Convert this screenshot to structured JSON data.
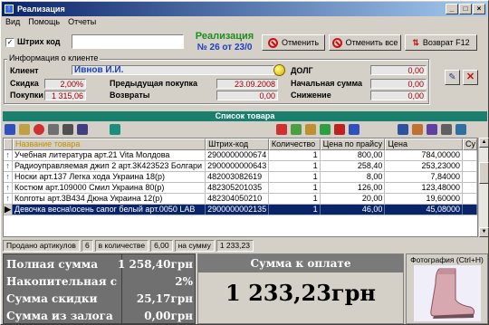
{
  "window": {
    "title": "Реализация"
  },
  "menu": [
    "Вид",
    "Помощь",
    "Отчеты"
  ],
  "barcode": {
    "label": "Штрих код",
    "checked": true,
    "value": ""
  },
  "sale": {
    "title": "Реализация",
    "number": "№ 26 от 23/0"
  },
  "buttons": {
    "cancel": "Отменить",
    "cancel_all": "Отменить все",
    "return": "Возврат F12"
  },
  "client_group": {
    "legend": "Информация о клиенте",
    "client_label": "Клиент",
    "client_value": "Ивнов И.И.",
    "discount_label": "Скидка",
    "discount_value": "2,00%",
    "purchases_label": "Покупки",
    "purchases_value": "1 315,06",
    "prev_purchase_label": "Предыдущая покупка",
    "prev_purchase_value": "23.09.2008",
    "returns_label": "Возвраты",
    "returns_value": "0,00",
    "debt_label": "ДОЛГ",
    "debt_value": "0,00",
    "start_sum_label": "Начальная сумма",
    "start_sum_value": "0,00",
    "reduction_label": "Снижение",
    "reduction_value": "0,00"
  },
  "goods": {
    "title": "Список товара",
    "columns": [
      "Название товара",
      "Штрих-код",
      "Количество",
      "Цена по прайсу",
      "Цена",
      "Су"
    ],
    "rows": [
      [
        "Учебная литература арт.21 Vita Молдова",
        "2900000000674",
        "1",
        "800,00",
        "784,00000"
      ],
      [
        "Радиоуправляемая джип 2 арт.3К423523 Болгари",
        "2900000000643",
        "1",
        "258,40",
        "253,23000"
      ],
      [
        "Носки арт.137 Легка хода Украина 18(р)",
        "482003082619",
        "1",
        "8,00",
        "7,84000"
      ],
      [
        "Костюм арт.109000 Смил Украина 80(р)",
        "482305201035",
        "1",
        "126,00",
        "123,48000"
      ],
      [
        "Колготы арт.3В434 Дюна Украина 12(р)",
        "482304050210",
        "1",
        "20,00",
        "19,60000"
      ],
      [
        "Девочка весна\\осень сапог белый арт.0050 LAB",
        "2900000002135",
        "1",
        "46,00",
        "45,08000"
      ]
    ],
    "selected_index": 5
  },
  "status": {
    "sold_label": "Продано артикулов",
    "sold_value": "6",
    "qty_label": "в количестве",
    "qty_value": "6,00",
    "sum_label": "на сумму",
    "sum_value": "1 233,23"
  },
  "totals": {
    "full_label": "Полная сумма",
    "full_value": "1 258,40грн",
    "accum_label": "Накопительная с",
    "accum_value": "2%",
    "discount_label": "Сумма скидки",
    "discount_value": "25,17грн",
    "pledge_label": "Сумма из залога",
    "pledge_value": "0,00грн"
  },
  "payment": {
    "label": "Сумма к оплате",
    "value": "1 233,23грн"
  },
  "photo": {
    "label": "Фотография (Ctrl+H)"
  },
  "colors": {
    "title_start": "#0a246a",
    "green_bar": "#1b7f6e",
    "sale_green": "#1d8f1d",
    "sale_blue": "#1a3fc0",
    "selected_row": "#0a246a"
  }
}
